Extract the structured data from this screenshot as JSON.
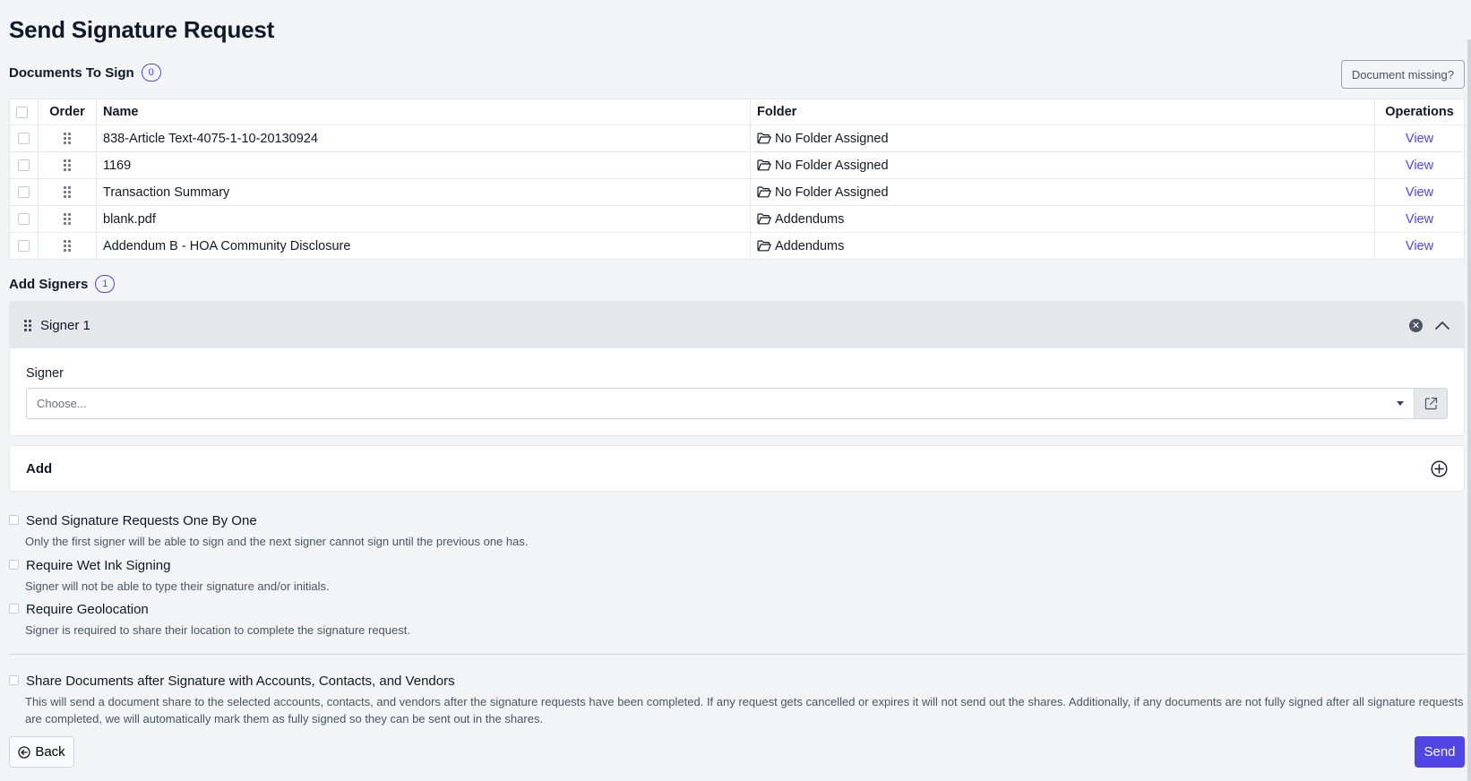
{
  "page": {
    "title": "Send Signature Request"
  },
  "documents": {
    "heading": "Documents To Sign",
    "count": "0",
    "missing_label": "Document missing?",
    "columns": {
      "order": "Order",
      "name": "Name",
      "folder": "Folder",
      "operations": "Operations"
    },
    "rows": [
      {
        "name": "838-Article Text-4075-1-10-20130924",
        "folder": "No Folder Assigned",
        "action": "View"
      },
      {
        "name": "1169",
        "folder": "No Folder Assigned",
        "action": "View"
      },
      {
        "name": "Transaction Summary",
        "folder": "No Folder Assigned",
        "action": "View"
      },
      {
        "name": "blank.pdf",
        "folder": "Addendums",
        "action": "View"
      },
      {
        "name": "Addendum B - HOA Community Disclosure",
        "folder": "Addendums",
        "action": "View"
      }
    ]
  },
  "signers": {
    "heading": "Add Signers",
    "count": "1",
    "items": [
      {
        "title": "Signer 1",
        "field_label": "Signer",
        "placeholder": "Choose..."
      }
    ],
    "add_label": "Add"
  },
  "options": [
    {
      "label": "Send Signature Requests One By One",
      "help": "Only the first signer will be able to sign and the next signer cannot sign until the previous one has."
    },
    {
      "label": "Require Wet Ink Signing",
      "help": "Signer will not be able to type their signature and/or initials."
    },
    {
      "label": "Require Geolocation",
      "help": "Signer is required to share their location to complete the signature request."
    }
  ],
  "share": {
    "label": "Share Documents after Signature with Accounts, Contacts, and Vendors",
    "help": "This will send a document share to the selected accounts, contacts, and vendors after the signature requests have been completed. If any request gets cancelled or expires it will not send out the shares. Additionally, if any documents are not fully signed after all signature requests are completed, we will automatically mark them as fully signed so they can be sent out in the shares."
  },
  "footer": {
    "back_label": "Back",
    "send_label": "Send"
  },
  "colors": {
    "accent": "#4f46e5",
    "background": "#f3f4f6"
  },
  "icons": {
    "drag": "grip-icon",
    "folder": "folder-open-icon",
    "remove": "x-circle-icon",
    "collapse": "chevron-up-icon",
    "external": "external-link-icon",
    "add": "plus-circle-icon",
    "back": "arrow-left-circle-icon"
  }
}
